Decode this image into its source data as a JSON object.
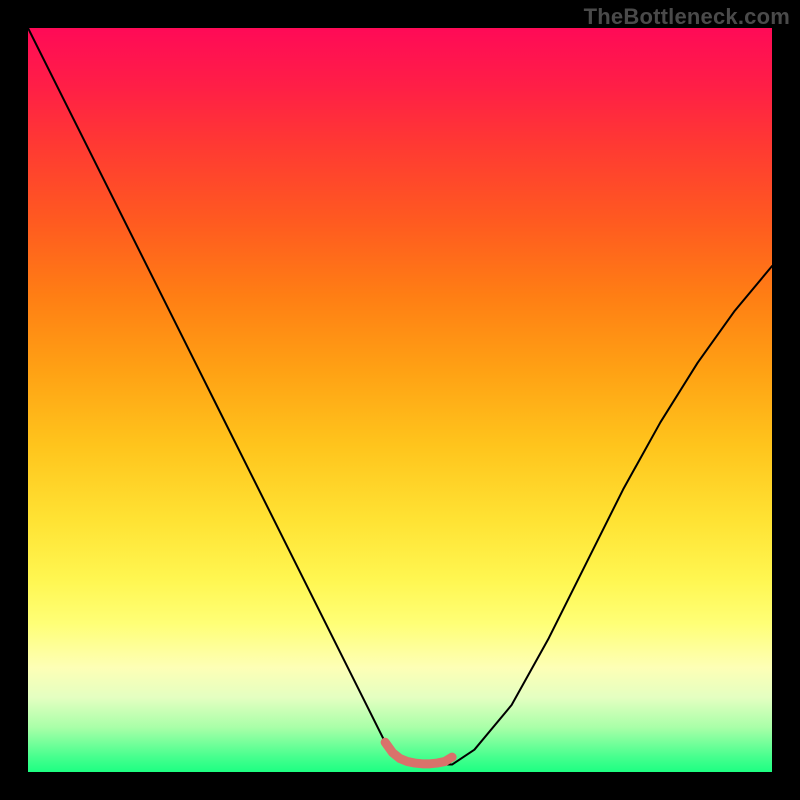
{
  "watermark": "TheBottleneck.com",
  "chart_data": {
    "type": "line",
    "title": "",
    "xlabel": "",
    "ylabel": "",
    "xlim": [
      0,
      100
    ],
    "ylim": [
      0,
      100
    ],
    "grid": false,
    "legend": false,
    "series": [
      {
        "name": "bottleneck-curve",
        "color": "#000000",
        "x": [
          0,
          5,
          10,
          15,
          20,
          25,
          30,
          35,
          40,
          45,
          48,
          50,
          52,
          55,
          57,
          60,
          65,
          70,
          75,
          80,
          85,
          90,
          95,
          100
        ],
        "y": [
          100,
          90,
          80,
          70,
          60,
          50,
          40,
          30,
          20,
          10,
          4,
          2,
          1,
          1,
          1,
          3,
          9,
          18,
          28,
          38,
          47,
          55,
          62,
          68
        ]
      },
      {
        "name": "highlight-segment",
        "color": "#d9726b",
        "x": [
          48,
          49,
          50,
          51,
          52,
          53,
          54,
          55,
          56,
          57
        ],
        "y": [
          4,
          2.6,
          1.8,
          1.4,
          1.2,
          1.1,
          1.1,
          1.2,
          1.4,
          2
        ]
      }
    ],
    "background": {
      "type": "vertical-gradient",
      "stops": [
        {
          "pos": 0.0,
          "color": "#ff0a57"
        },
        {
          "pos": 0.26,
          "color": "#ff5a20"
        },
        {
          "pos": 0.56,
          "color": "#ffc41c"
        },
        {
          "pos": 0.8,
          "color": "#ffff76"
        },
        {
          "pos": 0.94,
          "color": "#a9ffa8"
        },
        {
          "pos": 1.0,
          "color": "#1dff82"
        }
      ]
    }
  }
}
